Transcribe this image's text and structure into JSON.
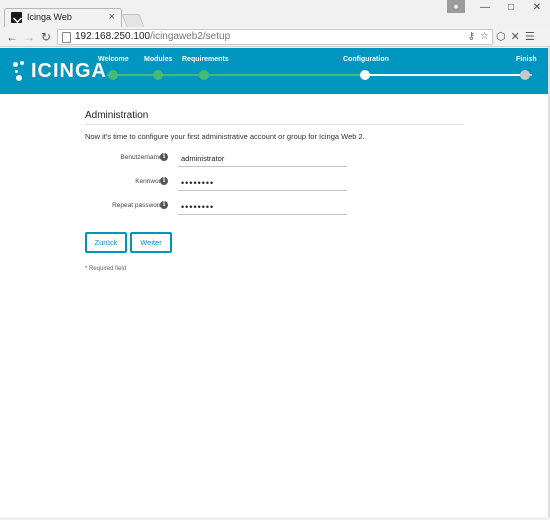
{
  "browser": {
    "tab_title": "Icinga Web",
    "tab_close": "×",
    "url_host": "192.168.250.100",
    "url_path": "/icingaweb2/setup",
    "window_buttons": {
      "minimize": "—",
      "maximize": "□",
      "close": "✕"
    }
  },
  "header": {
    "logo_text": "ICINGA",
    "steps": [
      {
        "label": "Welcome",
        "state": "done"
      },
      {
        "label": "Modules",
        "state": "done"
      },
      {
        "label": "Requirements",
        "state": "done"
      },
      {
        "label": "Configuration",
        "state": "current"
      },
      {
        "label": "Finish",
        "state": "pending"
      }
    ],
    "colors": {
      "brand": "#0096bf",
      "done": "#44bb77",
      "current": "#ffffff",
      "pending": "#c8c8c8"
    }
  },
  "form": {
    "title": "Administration",
    "intro": "Now it's time to configure your first administrative account or group for Icinga Web 2.",
    "fields": [
      {
        "label": "Benutzername *",
        "value": "administrator"
      },
      {
        "label": "Kennwort *",
        "value": "••••••••"
      },
      {
        "label": "Repeat password *",
        "value": "••••••••"
      }
    ],
    "back_label": "Zurück",
    "next_label": "Weiter",
    "required_note": "* Required field"
  }
}
